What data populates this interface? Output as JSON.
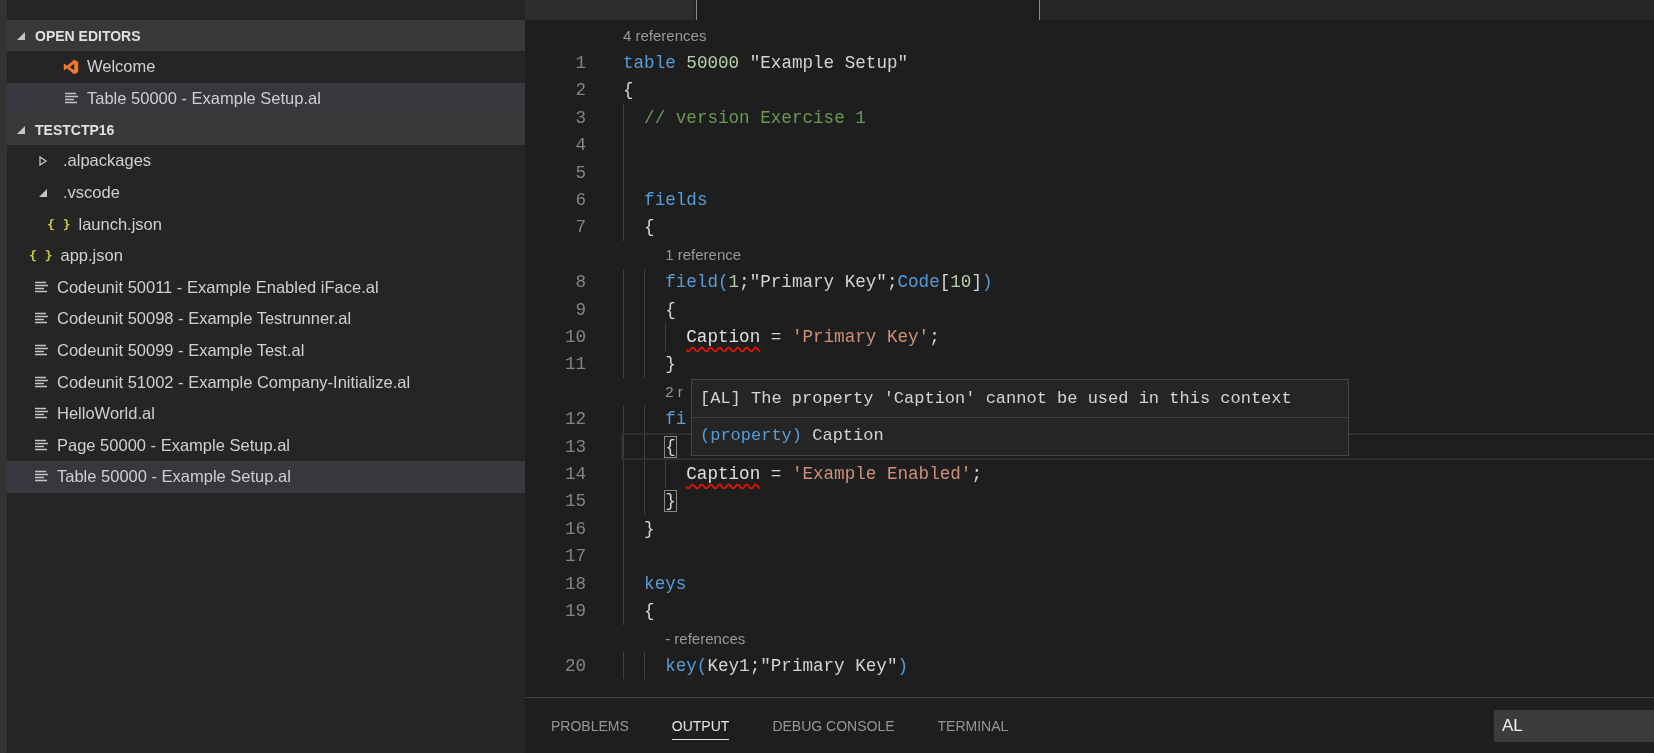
{
  "explorer": {
    "open_editors": {
      "title": "OPEN EDITORS",
      "expanded": true,
      "items": [
        {
          "label": "Welcome",
          "kind": "logo",
          "selected": false
        },
        {
          "label": "Table 50000 - Example Setup.al",
          "kind": "file",
          "selected": true
        }
      ]
    },
    "workspace": {
      "title": "TESTCTP16",
      "expanded": true,
      "items": [
        {
          "label": ".alpackages",
          "kind": "folder",
          "expanded": false,
          "selected": false
        },
        {
          "label": ".vscode",
          "kind": "folder",
          "expanded": true,
          "selected": false,
          "children": [
            {
              "label": "launch.json",
              "kind": "json",
              "icon_text": "{ }",
              "selected": false
            }
          ]
        },
        {
          "label": "app.json",
          "kind": "json",
          "icon_text": "{ }",
          "selected": false
        },
        {
          "label": "Codeunit 50011 - Example Enabled iFace.al",
          "kind": "file",
          "selected": false
        },
        {
          "label": "Codeunit 50098 - Example Testrunner.al",
          "kind": "file",
          "selected": false
        },
        {
          "label": "Codeunit 50099 - Example Test.al",
          "kind": "file",
          "selected": false
        },
        {
          "label": "Codeunit 51002 - Example Company-Initialize.al",
          "kind": "file",
          "selected": false
        },
        {
          "label": "HelloWorld.al",
          "kind": "file",
          "selected": false
        },
        {
          "label": "Page 50000 - Example Setup.al",
          "kind": "file",
          "selected": false
        },
        {
          "label": "Table 50000 - Example Setup.al",
          "kind": "file",
          "selected": true
        }
      ]
    }
  },
  "editor": {
    "lines": [
      {
        "kind": "lens",
        "text": "4 references"
      },
      {
        "kind": "code",
        "number": "1",
        "current": false,
        "tokens": [
          {
            "kind": "keyword",
            "text": "table"
          },
          {
            "kind": "number",
            "text": " 50000"
          },
          {
            "kind": "plain",
            "text": " \"Example Setup\""
          }
        ]
      },
      {
        "kind": "code",
        "number": "2",
        "current": false,
        "tokens": [
          {
            "kind": "plain",
            "text": "{"
          }
        ],
        "children": [
          {
            "kind": "code",
            "number": "3",
            "current": false,
            "tokens": [
              {
                "kind": "comment",
                "text": "// version Exercise 1"
              }
            ]
          },
          {
            "kind": "code",
            "number": "4",
            "current": false
          },
          {
            "kind": "code",
            "number": "5",
            "current": false
          },
          {
            "kind": "code",
            "number": "6",
            "current": false,
            "tokens": [
              {
                "kind": "keyword",
                "text": "fields"
              }
            ]
          },
          {
            "kind": "code",
            "number": "7",
            "current": false,
            "tokens": [
              {
                "kind": "plain",
                "text": "{"
              }
            ],
            "children": [
              {
                "kind": "lens",
                "text": "1 reference"
              },
              {
                "kind": "code",
                "number": "8",
                "current": false,
                "tokens": [
                  {
                    "kind": "keyword",
                    "text": "field("
                  },
                  {
                    "kind": "number",
                    "text": "1"
                  },
                  {
                    "kind": "plain",
                    "text": ";\"Primary Key\";"
                  },
                  {
                    "kind": "keyword",
                    "text": "Code"
                  },
                  {
                    "kind": "plain",
                    "text": "["
                  },
                  {
                    "kind": "number",
                    "text": "10"
                  },
                  {
                    "kind": "plain",
                    "text": "]"
                  },
                  {
                    "kind": "keyword",
                    "text": ")"
                  }
                ]
              },
              {
                "kind": "code",
                "number": "9",
                "current": false,
                "tokens": [
                  {
                    "kind": "plain",
                    "text": "{"
                  }
                ],
                "children": [
                  {
                    "kind": "code",
                    "number": "10",
                    "current": false,
                    "tokens": [
                      {
                        "kind": "error",
                        "text": "Caption"
                      },
                      {
                        "kind": "plain",
                        "text": " = "
                      },
                      {
                        "kind": "string",
                        "text": "'Primary Key'"
                      },
                      {
                        "kind": "plain",
                        "text": ";"
                      }
                    ]
                  }
                ]
              },
              {
                "kind": "code",
                "number": "11",
                "current": false,
                "tokens": [
                  {
                    "kind": "plain",
                    "text": "}"
                  }
                ]
              },
              {
                "kind": "lens",
                "text": "2 r"
              },
              {
                "kind": "code",
                "number": "12",
                "current": false,
                "tokens": [
                  {
                    "kind": "keyword",
                    "text": "fi"
                  }
                ]
              },
              {
                "kind": "code",
                "number": "13",
                "current": true,
                "tokens": [
                  {
                    "kind": "bracket",
                    "text": "{"
                  }
                ],
                "children": [
                  {
                    "kind": "code",
                    "number": "14",
                    "current": false,
                    "tokens": [
                      {
                        "kind": "error",
                        "text": "Caption"
                      },
                      {
                        "kind": "plain",
                        "text": " = "
                      },
                      {
                        "kind": "string",
                        "text": "'Example Enabled'"
                      },
                      {
                        "kind": "plain",
                        "text": ";"
                      }
                    ]
                  }
                ]
              },
              {
                "kind": "code",
                "number": "15",
                "current": false,
                "tokens": [
                  {
                    "kind": "bracket",
                    "text": "}"
                  }
                ]
              }
            ]
          },
          {
            "kind": "code",
            "number": "16",
            "current": false,
            "tokens": [
              {
                "kind": "plain",
                "text": "}"
              }
            ]
          },
          {
            "kind": "code",
            "number": "17",
            "current": false
          },
          {
            "kind": "code",
            "number": "18",
            "current": false,
            "tokens": [
              {
                "kind": "keyword",
                "text": "keys"
              }
            ]
          },
          {
            "kind": "code",
            "number": "19",
            "current": false,
            "tokens": [
              {
                "kind": "plain",
                "text": "{"
              }
            ],
            "children": [
              {
                "kind": "lens",
                "text": "- references"
              },
              {
                "kind": "code",
                "number": "20",
                "current": false,
                "tokens": [
                  {
                    "kind": "keyword",
                    "text": "key("
                  },
                  {
                    "kind": "plain",
                    "text": "Key1;\"Primary Key\""
                  },
                  {
                    "kind": "keyword",
                    "text": ")"
                  }
                ]
              }
            ]
          }
        ]
      }
    ],
    "hover": {
      "message": "[AL] The property 'Caption' cannot be used in this context",
      "signature": [
        {
          "kind": "keyword",
          "text": "(property)"
        },
        {
          "kind": "plain",
          "text": " Caption"
        }
      ]
    }
  },
  "panel": {
    "tabs": [
      {
        "label": "PROBLEMS",
        "selected": false
      },
      {
        "label": "OUTPUT",
        "selected": true
      },
      {
        "label": "DEBUG CONSOLE",
        "selected": false
      },
      {
        "label": "TERMINAL",
        "selected": false
      }
    ],
    "channel": {
      "value": "AL"
    }
  }
}
